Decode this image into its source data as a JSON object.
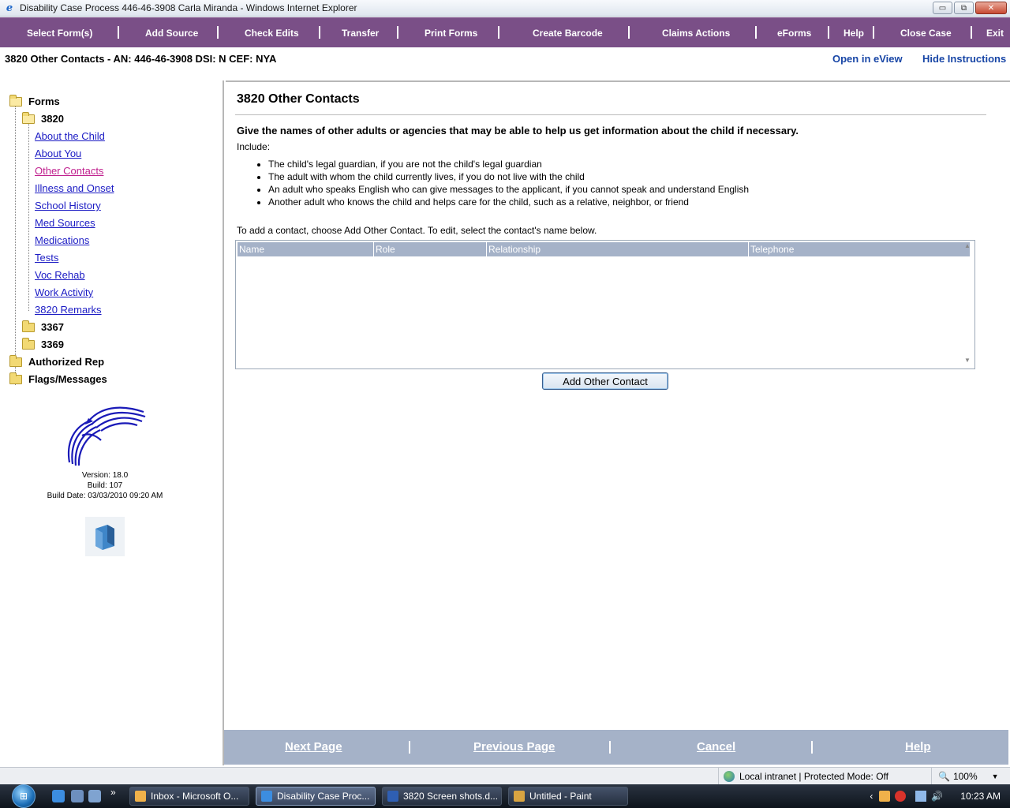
{
  "window": {
    "title": "Disability Case Process 446-46-3908 Carla Miranda - Windows Internet Explorer",
    "minimize": "▭",
    "maximize": "⧉",
    "close": "✕"
  },
  "menubar": {
    "items": [
      {
        "label": "Select Form(s)"
      },
      {
        "label": "Add Source"
      },
      {
        "label": "Check Edits"
      },
      {
        "label": "Transfer"
      },
      {
        "label": "Print Forms"
      },
      {
        "label": "Create Barcode"
      },
      {
        "label": "Claims Actions"
      },
      {
        "label": "eForms"
      },
      {
        "label": "Help"
      },
      {
        "label": "Close Case"
      },
      {
        "label": "Exit"
      }
    ],
    "color": "#7a4f87"
  },
  "subheader": {
    "case_line": "3820 Other Contacts - AN: 446-46-3908 DSI: N   CEF: NYA",
    "open_eview": "Open in eView",
    "hide_instructions": "Hide Instructions"
  },
  "tree": {
    "root": "Forms",
    "form_3820": "3820",
    "links": [
      {
        "label": "About the Child"
      },
      {
        "label": "About You"
      },
      {
        "label": "Other Contacts"
      },
      {
        "label": "Illness and Onset"
      },
      {
        "label": "School History"
      },
      {
        "label": "Med Sources"
      },
      {
        "label": "Medications"
      },
      {
        "label": "Tests"
      },
      {
        "label": "Voc Rehab"
      },
      {
        "label": "Work Activity"
      },
      {
        "label": "3820 Remarks"
      }
    ],
    "form_3367": "3367",
    "form_3369": "3369",
    "authorized_rep": "Authorized Rep",
    "flags_messages": "Flags/Messages",
    "version": "Version: 18.0",
    "build": "Build: 107",
    "build_date": "Build Date: 03/03/2010 09:20 AM"
  },
  "main": {
    "heading": "3820 Other Contacts",
    "intro": "Give the names of other adults or agencies that may be able to help us get information about the child if necessary.",
    "include": "Include:",
    "bullets": [
      "The child's legal guardian, if you are not the child's legal guardian",
      "The adult with whom the child currently lives, if you do not live with the child",
      "An adult who speaks English who can give messages to the applicant, if you cannot speak and understand English",
      "Another adult who knows the child and helps care for the child, such as a relative, neighbor, or friend"
    ],
    "add_note": "To add a contact, choose Add Other Contact. To edit, select the contact's name below.",
    "grid_columns": [
      "Name",
      "Role",
      "Relationship",
      "Telephone"
    ],
    "add_button": "Add Other Contact"
  },
  "footnav": {
    "next": "Next Page",
    "previous": "Previous Page",
    "cancel": "Cancel",
    "help": "Help"
  },
  "statusbar": {
    "zone": "Local intranet | Protected Mode: Off",
    "zoom": "100%"
  },
  "taskbar": {
    "tasks": [
      {
        "label": "Inbox - Microsoft O..."
      },
      {
        "label": "Disability Case Proc..."
      },
      {
        "label": "3820 Screen shots.d..."
      },
      {
        "label": "Untitled - Paint"
      }
    ],
    "clock": "10:23 AM"
  }
}
